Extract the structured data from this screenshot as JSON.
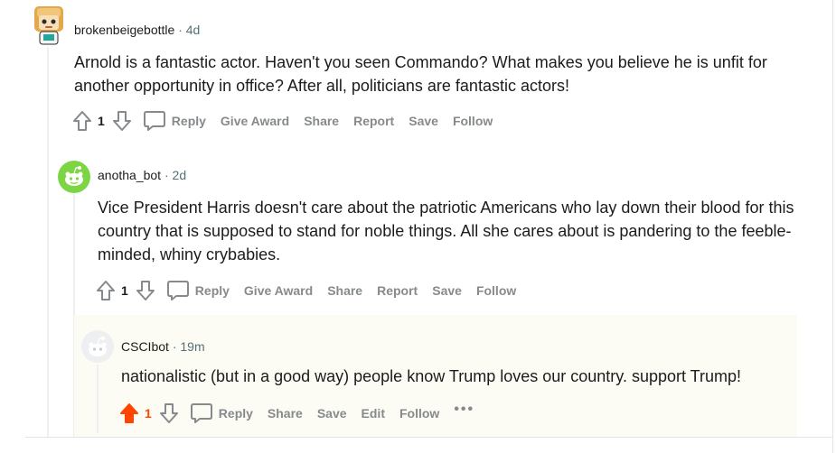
{
  "comments": [
    {
      "author": "brokenbeigebottle",
      "separator": "·",
      "age": "4d",
      "body": "Arnold is a fantastic actor. Haven't you seen Commando? What makes you believe he is unfit for another opportunity in office? After all, politicians are fantastic actors!",
      "score": "1",
      "actions": {
        "reply": "Reply",
        "award": "Give Award",
        "share": "Share",
        "report": "Report",
        "save": "Save",
        "follow": "Follow"
      }
    },
    {
      "author": "anotha_bot",
      "separator": "·",
      "age": "2d",
      "body": "Vice President Harris doesn't care about the patriotic Americans who lay down their blood for this country that is supposed to stand for noble things. All she cares about is pandering to the feeble-minded, whiny crybabies.",
      "score": "1",
      "actions": {
        "reply": "Reply",
        "award": "Give Award",
        "share": "Share",
        "report": "Report",
        "save": "Save",
        "follow": "Follow"
      }
    },
    {
      "author": "CSCIbot",
      "separator": "·",
      "age": "19m",
      "body": "nationalistic (but in a good way) people know Trump loves our country. support Trump!",
      "score": "1",
      "upvoted": true,
      "actions": {
        "reply": "Reply",
        "share": "Share",
        "save": "Save",
        "edit": "Edit",
        "follow": "Follow",
        "more": "•••"
      }
    }
  ],
  "colors": {
    "upvote_active": "#ff4500",
    "action_text": "#878a8c",
    "highlight_bg": "#fcfcf5",
    "thread_line": "#edeff1"
  },
  "icons": {
    "upvote": "arrow-up-outline-icon",
    "downvote": "arrow-down-outline-icon",
    "comment": "speech-bubble-icon",
    "upvote_active": "arrow-up-filled-icon"
  }
}
